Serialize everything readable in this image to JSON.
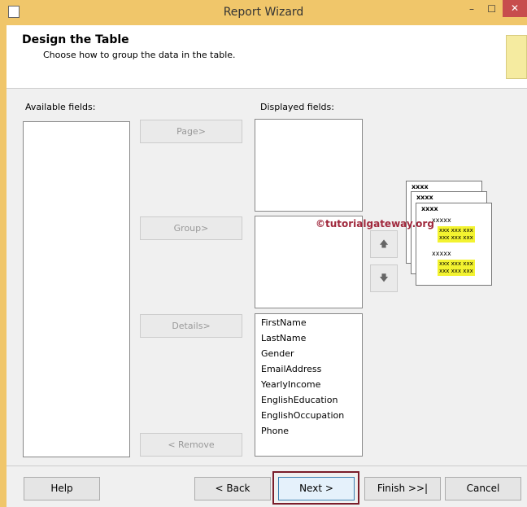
{
  "window": {
    "title": "Report Wizard",
    "minimize": "–",
    "maximize": "☐",
    "close": "✕"
  },
  "header": {
    "title": "Design the Table",
    "subtitle": "Choose how to group the data in the table."
  },
  "available": {
    "label": "Available fields:"
  },
  "displayed": {
    "label": "Displayed fields:",
    "details": [
      "FirstName",
      "LastName",
      "Gender",
      "EmailAddress",
      "YearlyIncome",
      "EnglishEducation",
      "EnglishOccupation",
      "Phone"
    ]
  },
  "buttons": {
    "page": "Page>",
    "group": "Group>",
    "details": "Details>",
    "remove": "< Remove",
    "up": "🡅",
    "down": "🡇"
  },
  "preview": {
    "h1": "xxxx",
    "h2": "xxxx",
    "h3": "xxxx",
    "g1": "xxxxx",
    "g2": "xxxxx",
    "row": "xxx xxx xxx"
  },
  "watermark": "©tutorialgateway.org",
  "footer": {
    "help": "Help",
    "back": "< Back",
    "next": "Next >",
    "finish": "Finish >>|",
    "cancel": "Cancel"
  }
}
